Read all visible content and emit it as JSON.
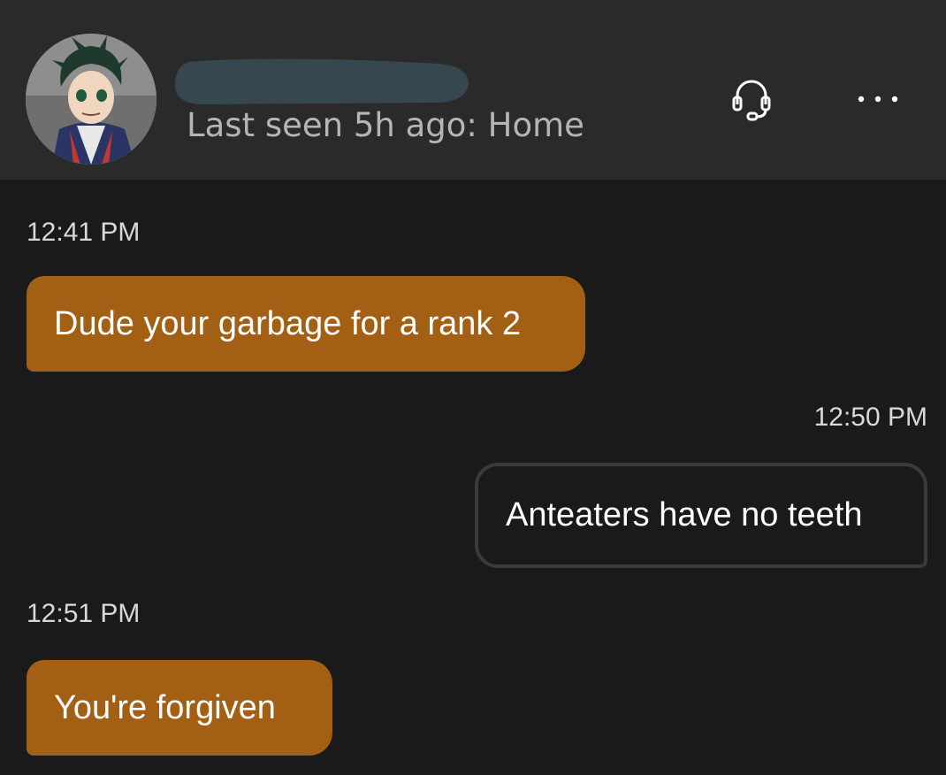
{
  "header": {
    "status": "Last seen 5h ago: Home",
    "icons": {
      "headset": "headset-icon",
      "more": "more-options-icon"
    }
  },
  "colors": {
    "incoming_bubble": "#a35f14",
    "outgoing_border": "#3a3a3a",
    "background": "#1a1a1a",
    "header_bg": "#2a2a2a"
  },
  "messages": [
    {
      "time": "12:41 PM",
      "text": "Dude your garbage for a rank 2",
      "direction": "incoming"
    },
    {
      "time": "12:50 PM",
      "text": "Anteaters have no teeth",
      "direction": "outgoing"
    },
    {
      "time": "12:51 PM",
      "text": "You're forgiven",
      "direction": "incoming"
    }
  ]
}
